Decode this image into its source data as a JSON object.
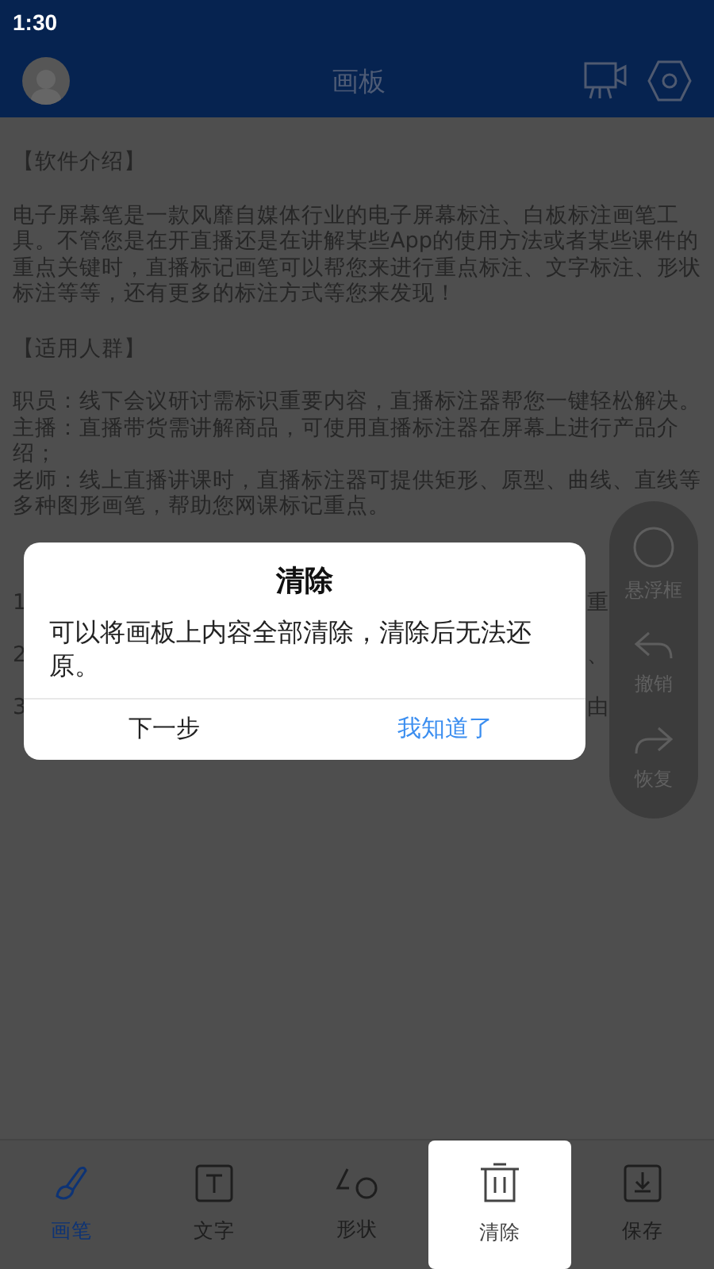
{
  "status_bar": {
    "time": "1:30"
  },
  "header": {
    "title": "画板"
  },
  "content": {
    "heading_1": "【软件介绍】",
    "intro": "电子屏幕笔是一款风靡自媒体行业的电子屏幕标注、白板标注画笔工具。不管您是在开直播还是在讲解某些App的使用方法或者某些课件的重点关键时，直播标记画笔可以帮您来进行重点标注、文字标注、形状标注等等，还有更多的标注方式等您来发现！",
    "heading_2": "【适用人群】",
    "audience": [
      "职员：线下会议研讨需标识重要内容，直播标注器帮您一键轻松解决。",
      "主播：直播带货需讲解商品，可使用直播标注器在屏幕上进行产品介绍；",
      "老师：线上直播讲课时，直播标注器可提供矩形、原型、曲线、直线等多种图形画笔，帮助您网课标记重点。"
    ],
    "partial_lines": [
      {
        "start": "1",
        "end": "重"
      },
      {
        "start": "2",
        "end": "、"
      },
      {
        "start": "3",
        "end": "由"
      }
    ]
  },
  "float_panel": [
    {
      "kind": "float",
      "label": "悬浮框"
    },
    {
      "kind": "undo",
      "label": "撤销"
    },
    {
      "kind": "redo",
      "label": "恢复"
    }
  ],
  "dialog": {
    "title": "清除",
    "message": "可以将画板上内容全部清除，清除后无法还原。",
    "buttons": [
      {
        "label": "下一步",
        "primary": false
      },
      {
        "label": "我知道了",
        "primary": true
      }
    ]
  },
  "toolbar": [
    {
      "kind": "pen",
      "label": "画笔",
      "selected": true,
      "highlighted": false
    },
    {
      "kind": "text",
      "label": "文字",
      "selected": false,
      "highlighted": false
    },
    {
      "kind": "shape",
      "label": "形状",
      "selected": false,
      "highlighted": false
    },
    {
      "kind": "clear",
      "label": "清除",
      "selected": false,
      "highlighted": true
    },
    {
      "kind": "save",
      "label": "保存",
      "selected": false,
      "highlighted": false
    }
  ]
}
